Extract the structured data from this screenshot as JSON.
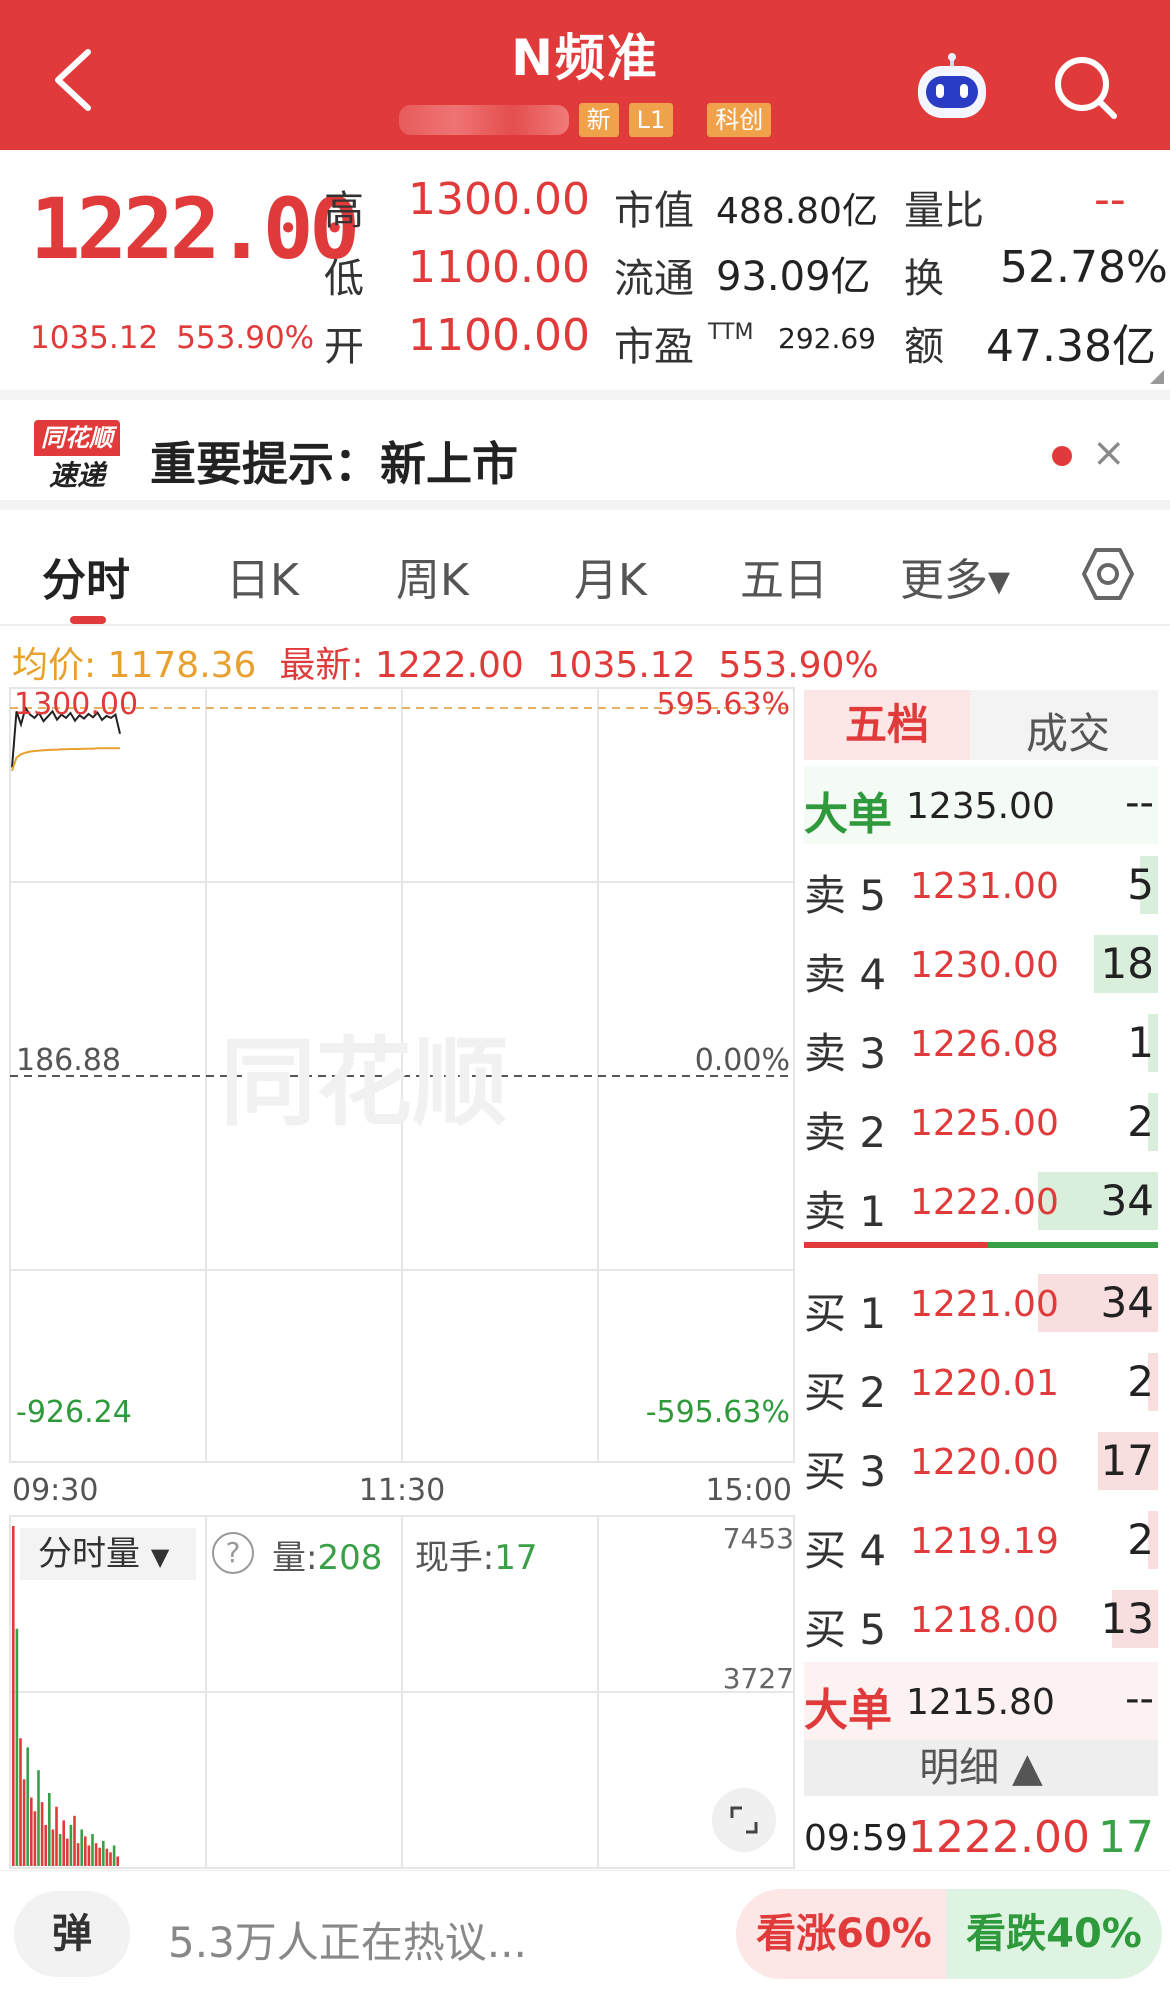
{
  "header": {
    "title": "N频准",
    "tags": [
      "新",
      "L1",
      "科创"
    ]
  },
  "quote": {
    "price": "1222.00",
    "change": "1035.12",
    "change_pct": "553.90%",
    "labels": {
      "high": "高",
      "low": "低",
      "open": "开",
      "mcap": "市值",
      "float": "流通",
      "pe": "市盈",
      "pe_sup": "TTM",
      "vol_ratio": "量比",
      "turnover": "换",
      "amount": "额"
    },
    "high": "1300.00",
    "low": "1100.00",
    "open": "1100.00",
    "mcap": "488.80亿",
    "float": "93.09亿",
    "pe": "292.69",
    "vol_ratio": "--",
    "turnover": "52.78%",
    "amount": "47.38亿"
  },
  "alert": {
    "logo_top": "同花顺",
    "logo_bottom": "速递",
    "text": "重要提示：新上市",
    "close": "×"
  },
  "tabs": [
    "分时",
    "日K",
    "周K",
    "月K",
    "五日",
    "更多▾"
  ],
  "info": {
    "avg_label": "均价:",
    "avg": "1178.36",
    "latest_label": "最新:",
    "latest": "1222.00",
    "change": "1035.12",
    "change_pct": "553.90%"
  },
  "chart": {
    "top_left": "1300.00",
    "top_right": "595.63%",
    "mid_left": "186.88",
    "mid_right": "0.00%",
    "bot_left": "-926.24",
    "bot_right": "-595.63%",
    "times": [
      "09:30",
      "11:30",
      "15:00"
    ],
    "watermark": "同花顺",
    "vol_selector": "分时量",
    "vol_label": "量:",
    "vol_value": "208",
    "hand_label": "现手:",
    "hand_value": "17",
    "vol_axis_top": "7453",
    "vol_axis_mid": "3727"
  },
  "chart_data": {
    "type": "line",
    "series": [
      {
        "values": [
          1120,
          1290,
          1250,
          1300,
          1280,
          1270,
          1285,
          1260,
          1275,
          1290,
          1265,
          1280,
          1270,
          1285,
          1262,
          1278,
          1268,
          1282,
          1272,
          1286,
          1264,
          1276,
          1270,
          1280,
          1222
        ]
      },
      {
        "values": [
          1110,
          1150,
          1160,
          1165,
          1168,
          1170,
          1171,
          1172,
          1173,
          1174,
          1174,
          1175,
          1175,
          1176,
          1176,
          1176,
          1177,
          1177,
          1177,
          1178,
          1178,
          1178,
          1178,
          1178,
          1178.36
        ]
      }
    ],
    "volume": [
      7453,
      5200,
      2800,
      1900,
      2600,
      1500,
      1200,
      2100,
      1400,
      900,
      1600,
      800,
      1300,
      700,
      1000,
      600,
      900,
      1100,
      500,
      800,
      650,
      450,
      700,
      500,
      400,
      550,
      380,
      300,
      450,
      208
    ],
    "ylim": [
      -926.24,
      1300
    ],
    "volume_ylim": [
      0,
      7453
    ]
  },
  "orderbook": {
    "tabs": [
      "五档",
      "成交"
    ],
    "big_sell": {
      "label": "大单",
      "price": "1235.00",
      "vol": "--"
    },
    "asks": [
      {
        "label": "卖 5",
        "price": "1231.00",
        "vol": "5",
        "bar": 0.15
      },
      {
        "label": "卖 4",
        "price": "1230.00",
        "vol": "18",
        "bar": 0.53
      },
      {
        "label": "卖 3",
        "price": "1226.08",
        "vol": "1",
        "bar": 0.03
      },
      {
        "label": "卖 2",
        "price": "1225.00",
        "vol": "2",
        "bar": 0.06
      },
      {
        "label": "卖 1",
        "price": "1222.00",
        "vol": "34",
        "bar": 1.0
      }
    ],
    "bids": [
      {
        "label": "买 1",
        "price": "1221.00",
        "vol": "34",
        "bar": 1.0
      },
      {
        "label": "买 2",
        "price": "1220.01",
        "vol": "2",
        "bar": 0.06
      },
      {
        "label": "买 3",
        "price": "1220.00",
        "vol": "17",
        "bar": 0.5
      },
      {
        "label": "买 4",
        "price": "1219.19",
        "vol": "2",
        "bar": 0.06
      },
      {
        "label": "买 5",
        "price": "1218.00",
        "vol": "13",
        "bar": 0.38
      }
    ],
    "big_buy": {
      "label": "大单",
      "price": "1215.80",
      "vol": "--"
    },
    "detail": "明细 ▲",
    "last": {
      "time": "09:59",
      "price": "1222.00",
      "vol": "17"
    }
  },
  "bottom": {
    "danmu": "弹",
    "hot": "5.3万人正在热议...",
    "up": "看涨60%",
    "down": "看跌40%"
  },
  "colors": {
    "brand": "#e03a3a",
    "up": "#e03a3a",
    "down": "#3aa048",
    "avg": "#e8a030"
  }
}
